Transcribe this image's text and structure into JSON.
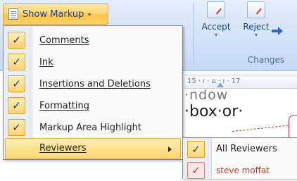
{
  "ribbon": {
    "accept_label": "Accept",
    "reject_label": "Reject",
    "group_label": "Changes"
  },
  "ruler": {
    "text": "15 · ı · ⌂ · ı · 17"
  },
  "document": {
    "line1": "·ndow",
    "line2": "·box·or·"
  },
  "show_markup": {
    "label": "Show Markup",
    "caret": "▾"
  },
  "menu": {
    "items": [
      {
        "label": "Comments",
        "checked": "✓"
      },
      {
        "label": "Ink",
        "checked": "✓"
      },
      {
        "label": "Insertions and Deletions",
        "checked": "✓"
      },
      {
        "label": "Formatting",
        "checked": "✓"
      },
      {
        "label": "Markup Area Highlight",
        "checked": "✓"
      },
      {
        "label": "Reviewers"
      }
    ]
  },
  "submenu": {
    "items": [
      {
        "label": "All Reviewers",
        "checked": "✓"
      },
      {
        "label": "steve moffat",
        "checked": "✓",
        "color": "#c0392b"
      }
    ]
  },
  "colors": {
    "highlight": "#ffd66f",
    "ribbon_text": "#15428b",
    "reviewer_red": "#c0392b"
  }
}
